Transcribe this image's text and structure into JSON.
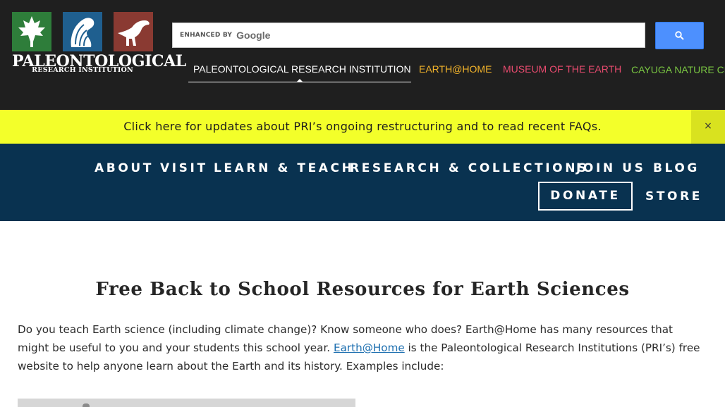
{
  "logo": {
    "wordmark": "PALEONTOLOGICAL",
    "subline": "RESEARCH INSTITUTION",
    "icons": [
      "maple-leaf-icon",
      "ammonite-shell-icon",
      "dinosaur-icon"
    ]
  },
  "search": {
    "enhanced_label": "ENHANCED BY",
    "provider": "Google",
    "button_icon": "search-icon",
    "button_color": "#4d90fe"
  },
  "site_nav": {
    "items": [
      {
        "label": "PALEONTOLOGICAL RESEARCH INSTITUTION",
        "color": "#ffffff"
      },
      {
        "label": "EARTH@HOME",
        "color": "#f3b42b"
      },
      {
        "label": "MUSEUM OF THE EARTH",
        "color": "#e94b6f"
      },
      {
        "label": "CAYUGA NATURE CENTER",
        "color": "#79c542"
      }
    ]
  },
  "alert": {
    "message": "Click here for updates about PRI’s ongoing restructuring and to read recent FAQs.",
    "close_label": "×",
    "background": "#f3ff2a"
  },
  "main_nav": {
    "items": [
      "ABOUT",
      "VISIT",
      "LEARN & TEACH",
      "RESEARCH & COLLECTIONS",
      "JOIN US",
      "BLOG"
    ],
    "donate": "DONATE",
    "store": "STORE",
    "background": "#093250"
  },
  "article": {
    "title": "Free Back to School Resources for Earth Sciences",
    "para_part1": "Do you teach Earth science (including climate change)? Know someone who does? Earth@Home has many resources that might be useful to you and your students this school year. ",
    "para_link": "Earth@Home",
    "para_part2": " is the Paleontological Research Institutions (PRI’s) free website to help anyone learn about the Earth and its history. Examples include:"
  }
}
